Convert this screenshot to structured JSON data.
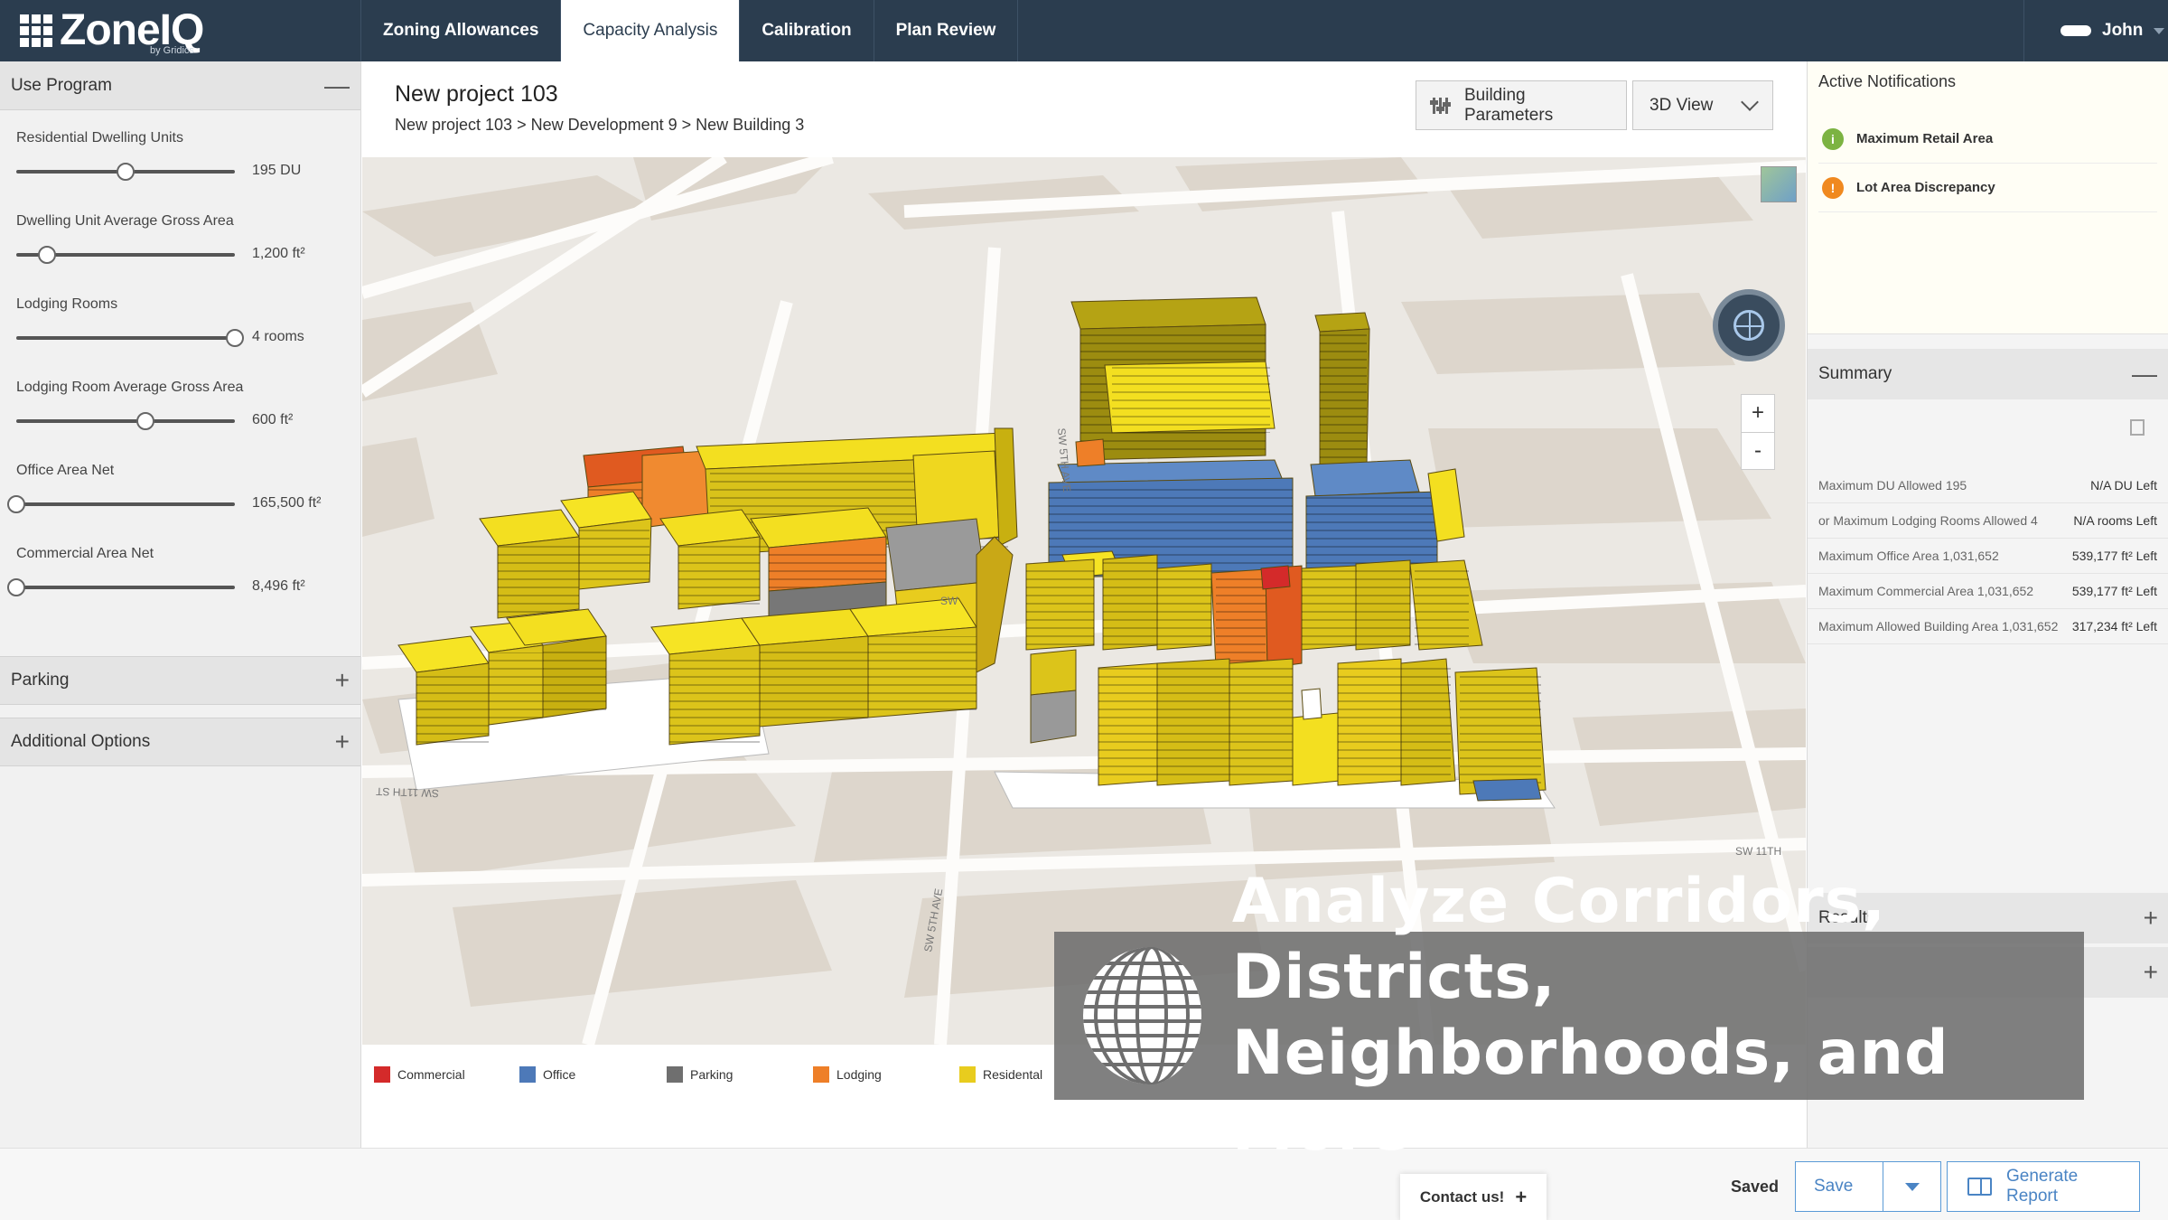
{
  "app": {
    "logo_text": "ZoneIQ",
    "logo_sub": "by Gridics"
  },
  "nav": {
    "tabs": [
      {
        "label": "Zoning Allowances",
        "active": false
      },
      {
        "label": "Capacity Analysis",
        "active": true
      },
      {
        "label": "Calibration",
        "active": false
      },
      {
        "label": "Plan Review",
        "active": false
      }
    ],
    "user": "John"
  },
  "left": {
    "use_program_title": "Use Program",
    "use_program_toggle": "—",
    "sliders": [
      {
        "label": "Residential Dwelling Units",
        "value": "195 DU",
        "position": 0.5
      },
      {
        "label": "Dwelling Unit Average Gross Area",
        "value": "1,200 ft²",
        "position": 0.14
      },
      {
        "label": "Lodging Rooms",
        "value": "4 rooms",
        "position": 1.0
      },
      {
        "label": "Lodging Room Average Gross Area",
        "value": "600 ft²",
        "position": 0.59
      },
      {
        "label": "Office Area Net",
        "value": "165,500 ft²",
        "position": 0.0
      },
      {
        "label": "Commercial Area Net",
        "value": "8,496 ft²",
        "position": 0.0
      }
    ],
    "parking_title": "Parking",
    "additional_title": "Additional Options",
    "expand_symbol": "+"
  },
  "header": {
    "project_title": "New project 103",
    "breadcrumb": "New project 103 > New Development 9 > New Building 3",
    "params_button": "Building Parameters",
    "view_select": "3D View"
  },
  "map": {
    "zoom_in": "+",
    "zoom_out": "-",
    "legend": [
      {
        "label": "Commercial",
        "color": "#d42a2a"
      },
      {
        "label": "Office",
        "color": "#4d79b8"
      },
      {
        "label": "Parking",
        "color": "#6f6f6f"
      },
      {
        "label": "Lodging",
        "color": "#ee7f28"
      },
      {
        "label": "Residental",
        "color": "#e8cc1e"
      }
    ],
    "banner_line1": "Analyze Corridors, Districts,",
    "banner_line2": "Neighborhoods, and More"
  },
  "right": {
    "notifications_title": "Active Notifications",
    "notifications": [
      {
        "label": "Maximum Retail Area",
        "icon": "i",
        "color": "#7cb342"
      },
      {
        "label": "Lot Area Discrepancy",
        "icon": "!",
        "color": "#f0891f"
      }
    ],
    "summary_title": "Summary",
    "summary_toggle": "—",
    "summary_rows": [
      {
        "label": "Maximum DU Allowed 195",
        "value": "N/A DU Left"
      },
      {
        "label": "or Maximum Lodging Rooms Allowed 4",
        "value": "N/A rooms Left"
      },
      {
        "label": "Maximum Office Area 1,031,652",
        "value": "539,177 ft² Left"
      },
      {
        "label": "Maximum Commercial Area 1,031,652",
        "value": "539,177 ft² Left"
      },
      {
        "label": "Maximum Allowed Building Area 1,031,652",
        "value": "317,234 ft² Left"
      }
    ],
    "results_title": "Results",
    "expand_symbol": "+"
  },
  "footer": {
    "contact": "Contact us!",
    "contact_plus": "+",
    "status": "Saved",
    "save": "Save",
    "generate": "Generate Report"
  }
}
